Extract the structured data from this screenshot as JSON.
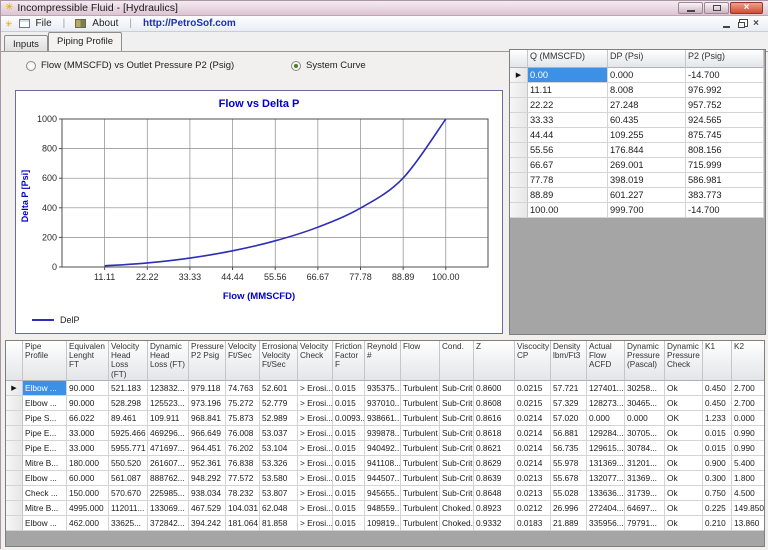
{
  "window": {
    "title": "Incompressible Fluid - [Hydraulics]",
    "app_icon": "✳",
    "close_glyph": "×"
  },
  "menu": {
    "separator": "|",
    "items": [
      {
        "label": "File"
      },
      {
        "label": "About"
      },
      {
        "label": "http://PetroSof.com"
      }
    ]
  },
  "tabs": {
    "items": [
      {
        "label": "Inputs",
        "active": false
      },
      {
        "label": "Piping Profile",
        "active": true
      }
    ]
  },
  "options": {
    "flow_vs_p2": {
      "label": "Flow (MMSCFD) vs Outlet Pressure P2 (Psig)",
      "selected": false
    },
    "system_curve": {
      "label": "System Curve",
      "selected": true
    }
  },
  "chart_data": {
    "type": "line",
    "title": "Flow vs Delta P",
    "xlabel": "Flow (MMSCFD)",
    "ylabel": "Delta P [Psi]",
    "grid": true,
    "legend_position": "bottom-left",
    "x": [
      11.11,
      22.22,
      33.33,
      44.44,
      55.56,
      66.67,
      77.78,
      88.89,
      100.0
    ],
    "series": [
      {
        "name": "DelP",
        "values": [
          8.008,
          27.248,
          60.435,
          109.255,
          176.844,
          269.001,
          398.019,
          601.227,
          999.7
        ]
      }
    ],
    "x_ticks": [
      "11.11",
      "22.22",
      "33.33",
      "44.44",
      "55.56",
      "66.67",
      "77.78",
      "88.89",
      "100.00"
    ],
    "y_ticks": [
      "0",
      "200",
      "400",
      "600",
      "800",
      "1000"
    ],
    "xlim": [
      0,
      111
    ],
    "ylim": [
      0,
      1000
    ],
    "line_color": "#2e2eb8",
    "label_color": "#0000cc"
  },
  "right_table": {
    "selector_width": 18,
    "arrow_row": 0,
    "selected": {
      "row": 0,
      "col": 0
    },
    "columns": [
      {
        "label": "Q (MMSCFD)",
        "width": 80
      },
      {
        "label": "DP (Psi)",
        "width": 78
      },
      {
        "label": "P2 (Psig)",
        "width": 78
      }
    ],
    "rows": [
      [
        "0.00",
        "0.000",
        "-14.700"
      ],
      [
        "11.11",
        "8.008",
        "976.992"
      ],
      [
        "22.22",
        "27.248",
        "957.752"
      ],
      [
        "33.33",
        "60.435",
        "924.565"
      ],
      [
        "44.44",
        "109.255",
        "875.745"
      ],
      [
        "55.56",
        "176.844",
        "808.156"
      ],
      [
        "66.67",
        "269.001",
        "715.999"
      ],
      [
        "77.78",
        "398.019",
        "586.981"
      ],
      [
        "88.89",
        "601.227",
        "383.773"
      ],
      [
        "100.00",
        "999.700",
        "-14.700"
      ]
    ]
  },
  "bottom_table": {
    "selector_width": 17,
    "arrow_row": 0,
    "selected": {
      "row": 0,
      "col": 0
    },
    "columns": [
      {
        "label": "Pipe Profile",
        "width": 44
      },
      {
        "label": "Equivalen Lenght FT",
        "width": 42
      },
      {
        "label": "Velocity Head Loss (FT)",
        "width": 39
      },
      {
        "label": "Dynamic Head Loss (FT)",
        "width": 41
      },
      {
        "label": "Pressure P2 Psig",
        "width": 37
      },
      {
        "label": "Velocity Ft/Sec",
        "width": 34
      },
      {
        "label": "Errosional Velocity Ft/Sec",
        "width": 38
      },
      {
        "label": "Velocity Check",
        "width": 35
      },
      {
        "label": "Friction Factor F",
        "width": 32
      },
      {
        "label": "Reynold #",
        "width": 36
      },
      {
        "label": "Flow",
        "width": 39
      },
      {
        "label": "Cond.",
        "width": 34
      },
      {
        "label": "Z",
        "width": 41
      },
      {
        "label": "Viscocity CP",
        "width": 36
      },
      {
        "label": "Density lbm/Ft3",
        "width": 36
      },
      {
        "label": "Actual Flow ACFD",
        "width": 38
      },
      {
        "label": "Dynamic Pressure (Pascal)",
        "width": 40
      },
      {
        "label": "Dynamic Pressure Check",
        "width": 38
      },
      {
        "label": "K1",
        "width": 29
      },
      {
        "label": "K2",
        "width": 36
      }
    ],
    "rows": [
      [
        "Elbow ...",
        "90.000",
        "521.183",
        "123832...",
        "979.118",
        "74.763",
        "52.601",
        "> Erosi...",
        "0.015",
        "935375...",
        "Turbulent",
        "Sub-Crit...",
        "0.8600",
        "0.0215",
        "57.721",
        "127401...",
        "30258...",
        "Ok",
        "0.450",
        "2.700"
      ],
      [
        "Elbow ...",
        "90.000",
        "528.298",
        "125523...",
        "973.196",
        "75.272",
        "52.779",
        "> Erosi...",
        "0.015",
        "937010...",
        "Turbulent",
        "Sub-Crit...",
        "0.8608",
        "0.0215",
        "57.329",
        "128273...",
        "30465...",
        "Ok",
        "0.450",
        "2.700"
      ],
      [
        "Pipe S...",
        "66.022",
        "89.461",
        "109.911",
        "968.841",
        "75.873",
        "52.989",
        "> Erosi...",
        "0.0093...",
        "938661...",
        "Turbulent",
        "Sub-Crit...",
        "0.8616",
        "0.0214",
        "57.020",
        "0.000",
        "0.000",
        "OK",
        "1.233",
        "0.000"
      ],
      [
        "Pipe E...",
        "33.000",
        "5925.466",
        "469296...",
        "966.649",
        "76.008",
        "53.037",
        "> Erosi...",
        "0.015",
        "939878...",
        "Turbulent",
        "Sub-Crit...",
        "0.8618",
        "0.0214",
        "56.881",
        "129284...",
        "30705...",
        "Ok",
        "0.015",
        "0.990"
      ],
      [
        "Pipe E...",
        "33.000",
        "5955.771",
        "471697...",
        "964.451",
        "76.202",
        "53.104",
        "> Erosi...",
        "0.015",
        "940492...",
        "Turbulent",
        "Sub-Crit...",
        "0.8621",
        "0.0214",
        "56.735",
        "129615...",
        "30784...",
        "Ok",
        "0.015",
        "0.990"
      ],
      [
        "Mitre B...",
        "180.000",
        "550.520",
        "261607...",
        "952.361",
        "76.838",
        "53.326",
        "> Erosi...",
        "0.015",
        "941108...",
        "Turbulent",
        "Sub-Crit...",
        "0.8629",
        "0.0214",
        "55.978",
        "131369...",
        "31201...",
        "Ok",
        "0.900",
        "5.400"
      ],
      [
        "Elbow ...",
        "60.000",
        "561.087",
        "888762...",
        "948.292",
        "77.572",
        "53.580",
        "> Erosi...",
        "0.015",
        "944507...",
        "Turbulent",
        "Sub-Crit...",
        "0.8639",
        "0.0213",
        "55.678",
        "132077...",
        "31369...",
        "Ok",
        "0.300",
        "1.800"
      ],
      [
        "Check ...",
        "150.000",
        "570.670",
        "225985...",
        "938.034",
        "78.232",
        "53.807",
        "> Erosi...",
        "0.015",
        "945655...",
        "Turbulent",
        "Sub-Crit...",
        "0.8648",
        "0.0213",
        "55.028",
        "133636...",
        "31739...",
        "Ok",
        "0.750",
        "4.500"
      ],
      [
        "Mitre B...",
        "4995.000",
        "112011...",
        "133069...",
        "467.529",
        "104.031",
        "62.048",
        "> Erosi...",
        "0.015",
        "948559...",
        "Turbulent",
        "Choked...",
        "0.8923",
        "0.0212",
        "26.996",
        "272404...",
        "64697...",
        "Ok",
        "0.225",
        "149.850"
      ],
      [
        "Elbow ...",
        "462.000",
        "33625...",
        "372842...",
        "394.242",
        "181.064",
        "81.858",
        "> Erosi...",
        "0.015",
        "109819...",
        "Turbulent",
        "Choked...",
        "0.9332",
        "0.0183",
        "21.889",
        "335956...",
        "79791...",
        "Ok",
        "0.210",
        "13.860"
      ]
    ]
  }
}
